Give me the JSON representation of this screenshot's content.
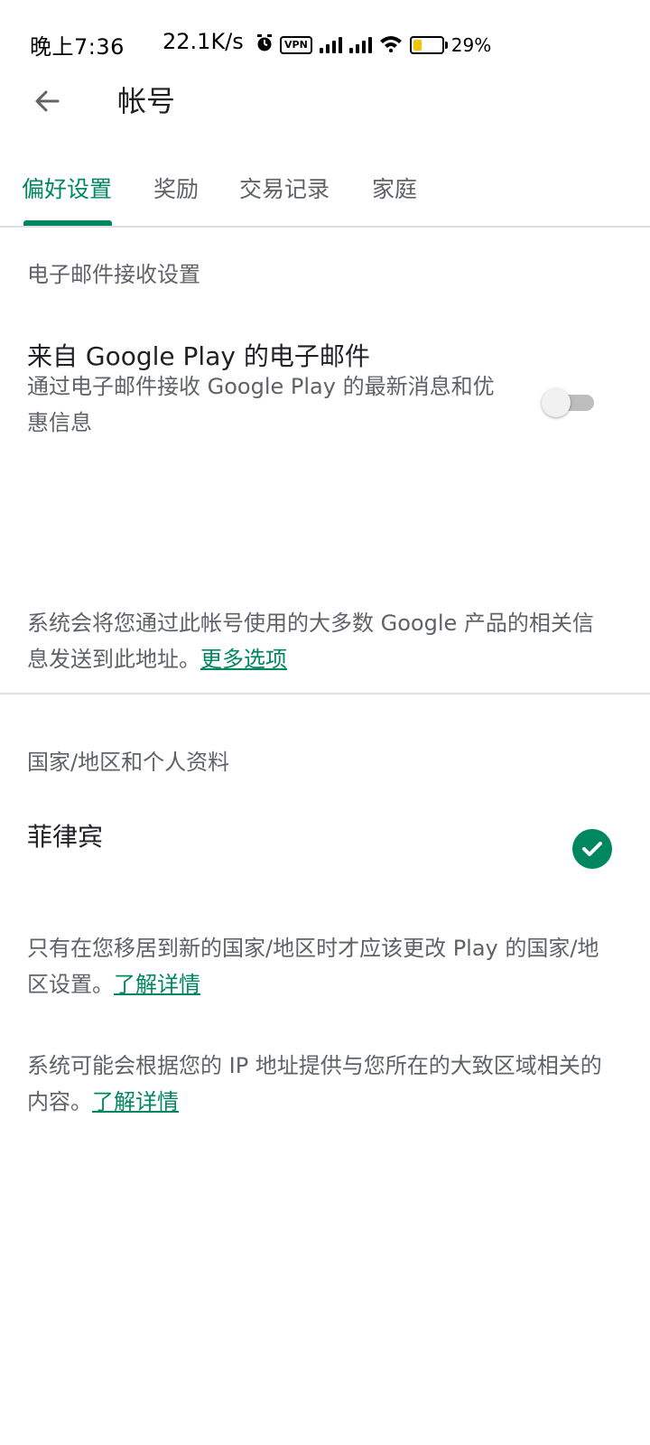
{
  "status_bar": {
    "time": "晚上7:36",
    "network_speed": "22.1K/s",
    "vpn_label": "VPN",
    "battery_percent": "29%",
    "icons": [
      "alarm-icon",
      "vpn-icon",
      "signal-icon",
      "signal-icon",
      "wifi-icon",
      "battery-icon"
    ]
  },
  "app_bar": {
    "back_icon": "arrow-left-icon",
    "title": "帐号"
  },
  "tabs": [
    {
      "label": "偏好设置",
      "active": true
    },
    {
      "label": "奖励",
      "active": false
    },
    {
      "label": "交易记录",
      "active": false
    },
    {
      "label": "家庭",
      "active": false
    }
  ],
  "email_section": {
    "header": "电子邮件接收设置",
    "item_title": "来自 Google Play 的电子邮件",
    "item_description": "通过电子邮件接收 Google Play 的最新消息和优惠信息",
    "toggle_on": false,
    "info_text": "系统会将您通过此帐号使用的大多数 Google 产品的相关信息发送到此地址。",
    "info_link": "更多选项"
  },
  "country_section": {
    "header": "国家/地区和个人资料",
    "country": "菲律宾",
    "selected": true,
    "note1_text": "只有在您移居到新的国家/地区时才应该更改 Play 的国家/地区设置。",
    "note1_link": "了解详情",
    "note2_text": "系统可能会根据您的 IP 地址提供与您所在的大致区域相关的内容。",
    "note2_link": "了解详情"
  },
  "colors": {
    "accent": "#01875f",
    "text_primary": "#202124",
    "text_secondary": "#5f6368",
    "divider": "#e0e0e0"
  }
}
